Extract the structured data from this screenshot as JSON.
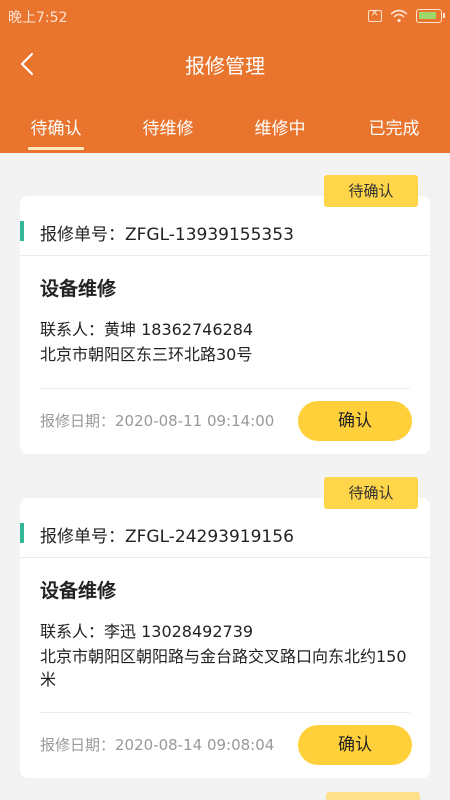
{
  "status_bar": {
    "time": "晚上7:52"
  },
  "header": {
    "title": "报修管理"
  },
  "tabs": [
    {
      "label": "待确认",
      "active": true
    },
    {
      "label": "待维修",
      "active": false
    },
    {
      "label": "维修中",
      "active": false
    },
    {
      "label": "已完成",
      "active": false
    }
  ],
  "orders": [
    {
      "badge": "待确认",
      "order_no": "报修单号：ZFGL-13939155353",
      "service": "设备维修",
      "contact": "联系人：黄坤 18362746284",
      "address": "北京市朝阳区东三环北路30号",
      "date": "报修日期：2020-08-11 09:14:00",
      "button": "确认"
    },
    {
      "badge": "待确认",
      "order_no": "报修单号：ZFGL-24293919156",
      "service": "设备维修",
      "contact": "联系人：李迅 13028492739",
      "address": "北京市朝阳区朝阳路与金台路交叉路口向东北约150米",
      "date": "报修日期：2020-08-14 09:08:04",
      "button": "确认"
    }
  ],
  "colors": {
    "header": "#e8742e",
    "badge": "#ffd54a",
    "button": "#ffd03a",
    "accent": "#34b796"
  }
}
